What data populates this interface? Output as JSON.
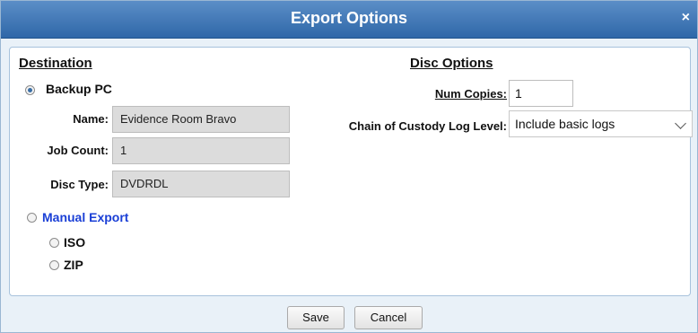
{
  "dialog": {
    "title": "Export Options",
    "close_glyph": "×"
  },
  "destination": {
    "title": "Destination",
    "backup_pc": {
      "label": "Backup PC",
      "selected": true
    },
    "fields": {
      "name_label": "Name:",
      "name_value": "Evidence Room Bravo",
      "job_count_label": "Job Count:",
      "job_count_value": "1",
      "disc_type_label": "Disc Type:",
      "disc_type_value": "DVDRDL"
    },
    "manual_export": {
      "label": "Manual Export",
      "selected": false
    },
    "formats": [
      {
        "label": "ISO",
        "selected": false
      },
      {
        "label": "ZIP",
        "selected": false
      }
    ]
  },
  "disc_options": {
    "title": "Disc Options",
    "num_copies_label": "Num Copies:",
    "num_copies_value": "1",
    "log_level_label": "Chain of Custody Log Level:",
    "log_level_value": "Include basic logs"
  },
  "buttons": {
    "save": "Save",
    "cancel": "Cancel"
  },
  "colors": {
    "titlebar": "#3f77b8",
    "link_blue": "#1a3fd6",
    "panel_border": "#a7c2dc"
  }
}
